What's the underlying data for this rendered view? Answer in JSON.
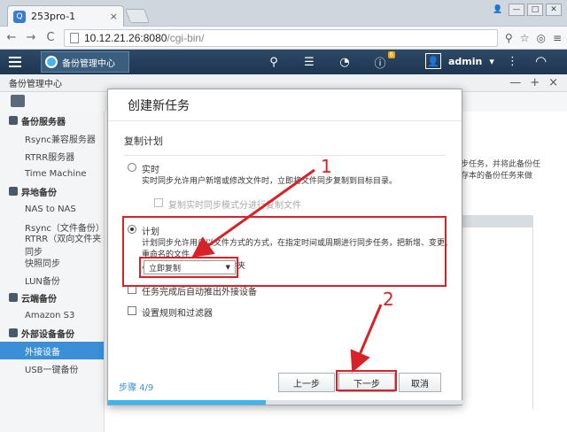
{
  "browser": {
    "tab_title": "253pro-1",
    "tab_close": "×",
    "url_host": "10.12.21.26:8080",
    "url_path": "/cgi-bin/",
    "nav": {
      "back": "←",
      "forward": "→",
      "reload": "C"
    }
  },
  "app_header": {
    "app_tab_label": "备份管理中心",
    "user_name": "admin",
    "user_caret": "▾",
    "info_badge": "6",
    "more": "⋮"
  },
  "app_window": {
    "title": "备份管理中心",
    "controls": [
      "—",
      "+",
      "×"
    ]
  },
  "sidebar": {
    "groups": [
      {
        "label": "备份服务器",
        "items": [
          "Rsync兼容服务器",
          "RTRR服务器",
          "Time Machine"
        ]
      },
      {
        "label": "异地备份",
        "items": [
          "NAS to NAS",
          "Rsync（文件备份）",
          "RTRR（双向文件夹同步",
          "快照同步",
          "LUN备份"
        ]
      },
      {
        "label": "云端备份",
        "items": [
          "Amazon S3"
        ]
      },
      {
        "label": "外部设备备份",
        "items": [
          "外接设备",
          "USB一键备份"
        ]
      }
    ],
    "active_item": "外接设备"
  },
  "background": {
    "text_line1": "步任务，并将此备份任",
    "text_line2": "存本的备份任务来做"
  },
  "modal": {
    "title": "创建新任务",
    "section": "复制计划",
    "option_realtime": "实时",
    "realtime_desc": "实时同步允许用户新增或修改文件时，立即将文件同步复制到目标目录。",
    "realtime_sub": "复制实时同步模式分进行复制文件",
    "option_schedule": "计划",
    "schedule_desc_line1": "计划同步允许用户以文件方式的方式，在指定时间或周期进行同步任务，把新增、变更、重命名的文件",
    "schedule_desc_line2": "从源文件夹拷贝到目标文件夹",
    "schedule_select": "立即复制",
    "check_auto": "任务完成后自动推出外接设备",
    "check_rules": "设置规则和过滤器",
    "step_label": "步骤 4/9",
    "btn_prev": "上一步",
    "btn_next": "下一步",
    "btn_cancel": "取消",
    "progress": 0.444
  },
  "annotations": {
    "one": "1",
    "two": "2"
  },
  "colors": {
    "accent": "#3b8fd6",
    "annotation": "#d92128",
    "header": "#1d3550"
  }
}
